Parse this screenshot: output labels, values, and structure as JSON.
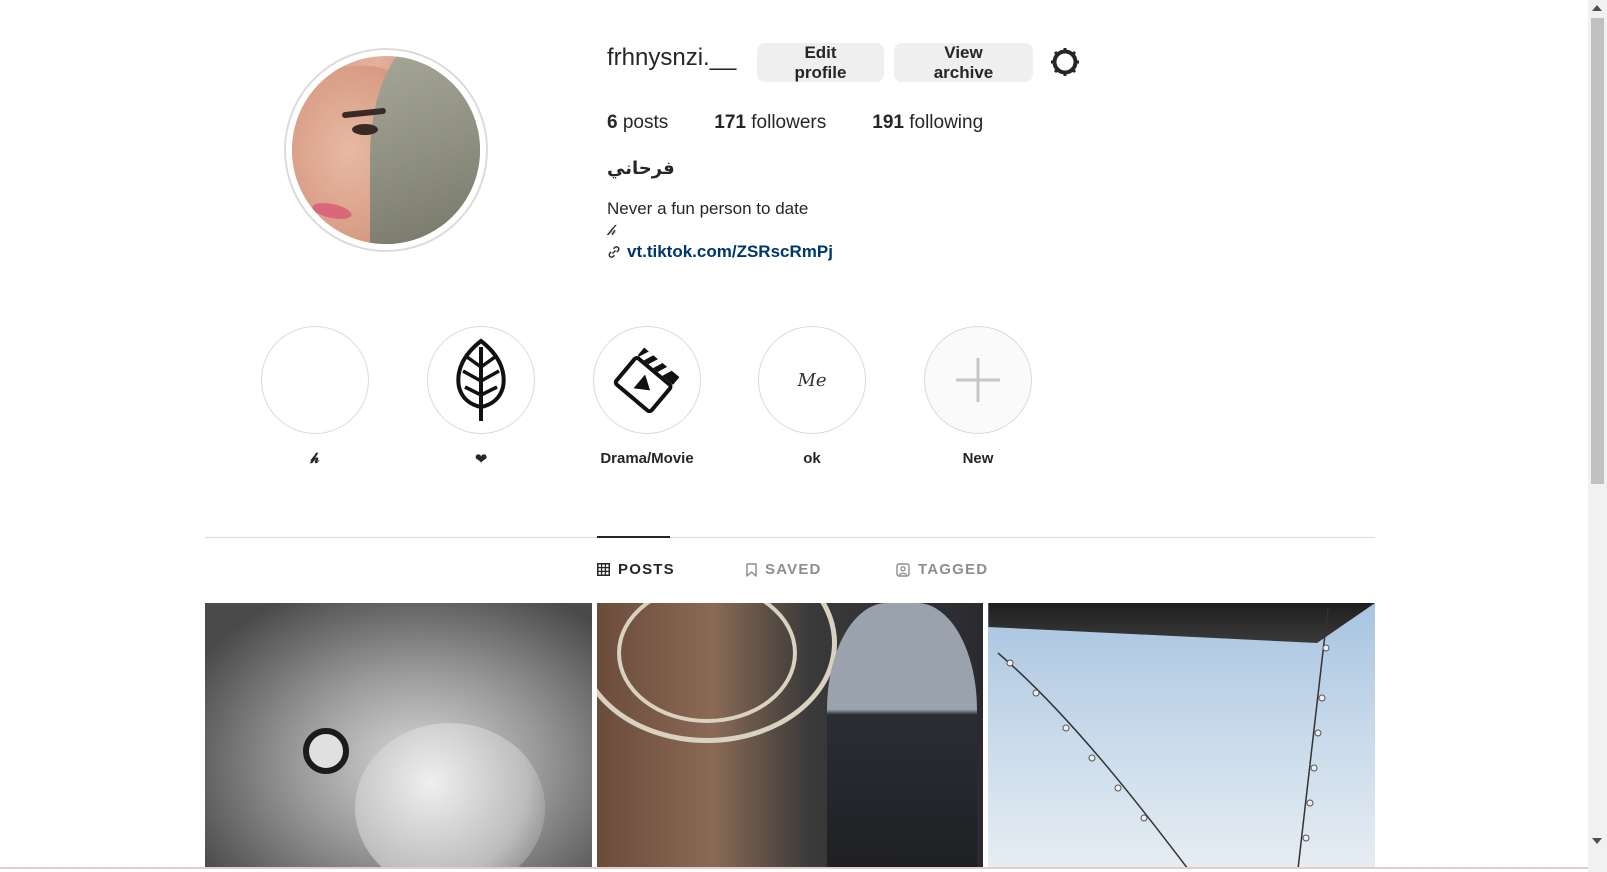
{
  "profile": {
    "username": "frhnysnzi.__",
    "edit_label": "Edit profile",
    "archive_label": "View archive",
    "stats": {
      "posts_count": "6",
      "posts_label": "posts",
      "followers_count": "171",
      "followers_label": "followers",
      "following_count": "191",
      "following_label": "following"
    },
    "full_name": "فرحاني",
    "bio_line1": "Never a fun person to date",
    "bio_line2": "𝒽",
    "link": "vt.tiktok.com/ZSRscRmPj",
    "link_icon": "link-icon",
    "settings_icon": "gear-icon"
  },
  "highlights": [
    {
      "label": "𝒽",
      "icon": "blank"
    },
    {
      "label": "❤",
      "icon": "leaf-icon"
    },
    {
      "label": "Drama/Movie",
      "icon": "clapperboard-icon"
    },
    {
      "label": "ok",
      "icon": "me-text",
      "cover_text": "Me"
    },
    {
      "label": "New",
      "icon": "plus-icon"
    }
  ],
  "tabs": [
    {
      "label": "POSTS",
      "icon": "grid-icon",
      "active": true
    },
    {
      "label": "SAVED",
      "icon": "bookmark-icon",
      "active": false
    },
    {
      "label": "TAGGED",
      "icon": "tag-person-icon",
      "active": false
    }
  ],
  "colors": {
    "link": "#00376b",
    "button_bg": "#efefef",
    "text": "#262626",
    "muted": "#8e8e8e"
  }
}
